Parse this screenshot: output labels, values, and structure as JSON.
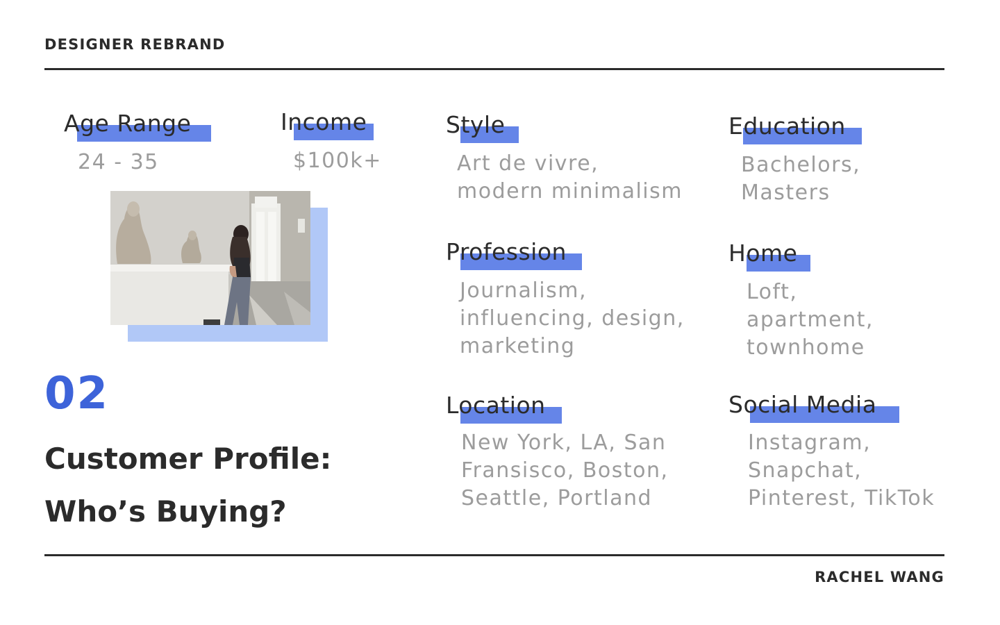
{
  "header": {
    "title": "DESIGNER REBRAND"
  },
  "footer": {
    "author": "RACHEL WANG"
  },
  "slide": {
    "number": "02",
    "title_line1": "Customer Profile:",
    "title_line2": "Who’s Buying?"
  },
  "photo": {
    "description_icon": "museum-photo"
  },
  "colors": {
    "highlight": "#6585e8",
    "accent_number": "#3d63d9",
    "photo_shadow": "#b1c8f7",
    "text_dark": "#2b2b2b",
    "text_muted": "#9c9c9c"
  },
  "profile": {
    "age": {
      "label": "Age Range",
      "lines": [
        "24 - 35"
      ]
    },
    "income": {
      "label": "Income",
      "lines": [
        "$100k+"
      ]
    },
    "style": {
      "label": "Style",
      "lines": [
        "Art de vivre,",
        "modern minimalism"
      ]
    },
    "education": {
      "label": "Education",
      "lines": [
        "Bachelors,",
        "Masters"
      ]
    },
    "profession": {
      "label": "Profession",
      "lines": [
        "Journalism,",
        "influencing, design,",
        "marketing"
      ]
    },
    "home": {
      "label": "Home",
      "lines": [
        "Loft,",
        "apartment,",
        "townhome"
      ]
    },
    "location": {
      "label": "Location",
      "lines": [
        "New York, LA, San",
        "Fransisco, Boston,",
        "Seattle, Portland"
      ]
    },
    "social": {
      "label": "Social Media",
      "lines": [
        "Instagram,",
        "Snapchat,",
        "Pinterest, TikTok"
      ]
    }
  }
}
